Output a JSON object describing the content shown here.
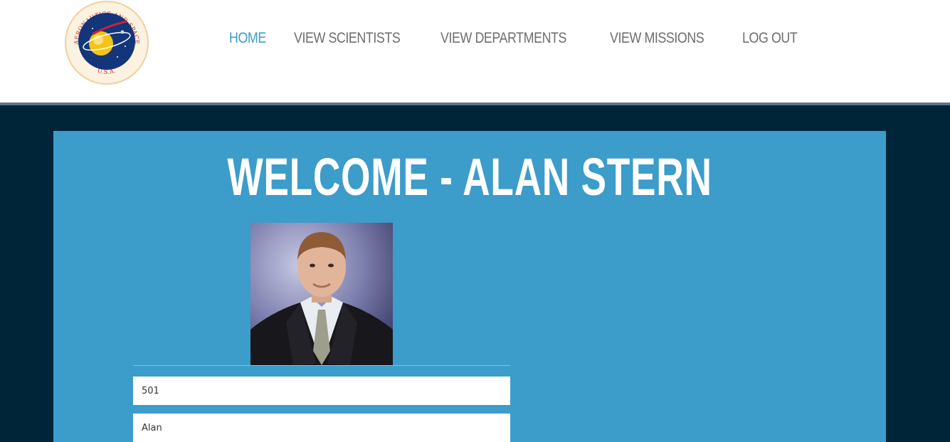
{
  "header": {
    "logo": {
      "icon": "nasa-seal-icon",
      "seal_text_top": "AERONAUTICS AND SPACE",
      "seal_text_left": "NATIONAL",
      "seal_text_right": "ADMINISTRATION",
      "seal_text_bottom": "U.S.A."
    },
    "nav": [
      {
        "label": "HOME",
        "active": true
      },
      {
        "label": "VIEW SCIENTISTS",
        "active": false
      },
      {
        "label": "VIEW DEPARTMENTS",
        "active": false
      },
      {
        "label": "VIEW MISSIONS",
        "active": false
      },
      {
        "label": "LOG OUT",
        "active": false
      }
    ]
  },
  "main": {
    "welcome_title": "WELCOME - ALAN STERN",
    "profile_photo_icon": "scientist-portrait",
    "fields": {
      "id_value": "501",
      "first_name_value": "Alan"
    }
  },
  "colors": {
    "header_bg": "#ffffff",
    "page_bg": "#002539",
    "panel_bg": "#3c9cca",
    "nav_active": "#3b9cca",
    "nav_default": "#6e6e6e"
  }
}
